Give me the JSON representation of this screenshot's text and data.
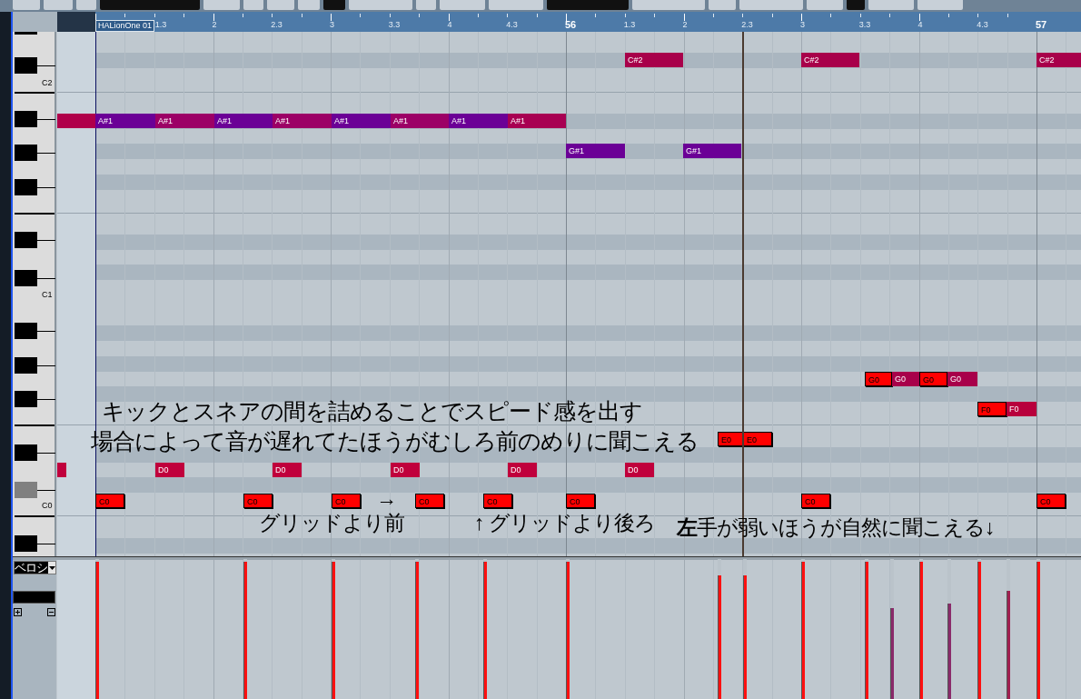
{
  "ruler": {
    "track_tag": "HALionOne 01",
    "labels": [
      {
        "text": "1.3",
        "kind": "beat"
      },
      {
        "text": "2",
        "kind": "beat"
      },
      {
        "text": "2.3",
        "kind": "beat"
      },
      {
        "text": "3",
        "kind": "beat"
      },
      {
        "text": "3.3",
        "kind": "beat"
      },
      {
        "text": "4",
        "kind": "beat"
      },
      {
        "text": "4.3",
        "kind": "beat"
      },
      {
        "text": "56",
        "kind": "bar"
      },
      {
        "text": "1.3",
        "kind": "beat"
      },
      {
        "text": "2",
        "kind": "beat"
      },
      {
        "text": "2.3",
        "kind": "beat"
      },
      {
        "text": "3",
        "kind": "beat"
      },
      {
        "text": "3.3",
        "kind": "beat"
      },
      {
        "text": "4",
        "kind": "beat"
      },
      {
        "text": "4.3",
        "kind": "beat"
      },
      {
        "text": "57",
        "kind": "bar"
      }
    ]
  },
  "keyboard": {
    "labels": [
      "C2",
      "C1",
      "C0"
    ]
  },
  "notes": [
    {
      "label": "C#2",
      "color": "#a8004a"
    },
    {
      "label": "C#2",
      "color": "#a8004a"
    },
    {
      "label": "C#2",
      "color": "#a8004a"
    },
    {
      "color": "#b0004a"
    },
    {
      "label": "A#1",
      "color": "#6b0096"
    },
    {
      "label": "A#1",
      "color": "#9c0066"
    },
    {
      "label": "A#1",
      "color": "#6b0096"
    },
    {
      "label": "A#1",
      "color": "#9c0066"
    },
    {
      "label": "A#1",
      "color": "#6b0096"
    },
    {
      "label": "A#1",
      "color": "#9c0066"
    },
    {
      "label": "A#1",
      "color": "#6b0096"
    },
    {
      "label": "A#1",
      "color": "#a80052"
    },
    {
      "label": "G#1",
      "color": "#6b0096"
    },
    {
      "label": "G#1",
      "color": "#6b0096"
    },
    {
      "label": "G0",
      "color": "#ff0000"
    },
    {
      "label": "G0",
      "color": "#a8004a"
    },
    {
      "label": "G0",
      "color": "#ff0000"
    },
    {
      "label": "G0",
      "color": "#a8004a"
    },
    {
      "label": "F0",
      "color": "#ff0000"
    },
    {
      "label": "F0",
      "color": "#b8003c"
    },
    {
      "label": "E0",
      "color": "#ff0000"
    },
    {
      "label": "E0",
      "color": "#ff0000"
    },
    {
      "color": "#c0003c"
    },
    {
      "label": "D0",
      "color": "#c0003c"
    },
    {
      "label": "D0",
      "color": "#c0003c"
    },
    {
      "label": "D0",
      "color": "#c0003c"
    },
    {
      "label": "D0",
      "color": "#c0003c"
    },
    {
      "label": "D0",
      "color": "#c0003c"
    },
    {
      "label": "C0",
      "color": "#ff0000"
    },
    {
      "label": "C0",
      "color": "#ff0000"
    },
    {
      "label": "C0",
      "color": "#ff0000"
    },
    {
      "label": "C0",
      "color": "#ff0000"
    },
    {
      "label": "C0",
      "color": "#ff0000"
    },
    {
      "label": "C0",
      "color": "#ff0000"
    },
    {
      "label": "C0",
      "color": "#ff0000"
    },
    {
      "label": "C0",
      "color": "#ff0000"
    }
  ],
  "annotations": [
    {
      "text": "キックとスネアの間を詰めることでスピード感を出す"
    },
    {
      "text": "場合によって音が遅れてたほうがむしろ前のめりに聞こえる"
    },
    {
      "text": "グリッドより前"
    },
    {
      "text": "→"
    },
    {
      "text": "↑ グリッドより後ろ"
    },
    {
      "text": "**左**手が弱いほうが自然に聞こえる↓"
    }
  ],
  "velocity_lane": {
    "parameter": "ベロシ",
    "bars": [
      {
        "level": 0.98,
        "color": "#ff1010"
      },
      {
        "level": 0.98,
        "color": "#ff1010"
      },
      {
        "level": 0.98,
        "color": "#ff1010"
      },
      {
        "level": 0.98,
        "color": "#ff1010"
      },
      {
        "level": 0.98,
        "color": "#ff1010"
      },
      {
        "level": 0.98,
        "color": "#ff1010"
      },
      {
        "level": 0.88,
        "color": "#ff1010"
      },
      {
        "level": 0.88,
        "color": "#ff1010"
      },
      {
        "level": 0.98,
        "color": "#ff1010"
      },
      {
        "level": 0.98,
        "color": "#ff1010"
      },
      {
        "level": 0.65,
        "color": "#8a2a6a"
      },
      {
        "level": 0.98,
        "color": "#ff1010"
      },
      {
        "level": 0.68,
        "color": "#8a2a6a"
      },
      {
        "level": 0.98,
        "color": "#ff1010"
      },
      {
        "level": 0.77,
        "color": "#a02050"
      },
      {
        "level": 0.98,
        "color": "#ff1010"
      }
    ]
  }
}
